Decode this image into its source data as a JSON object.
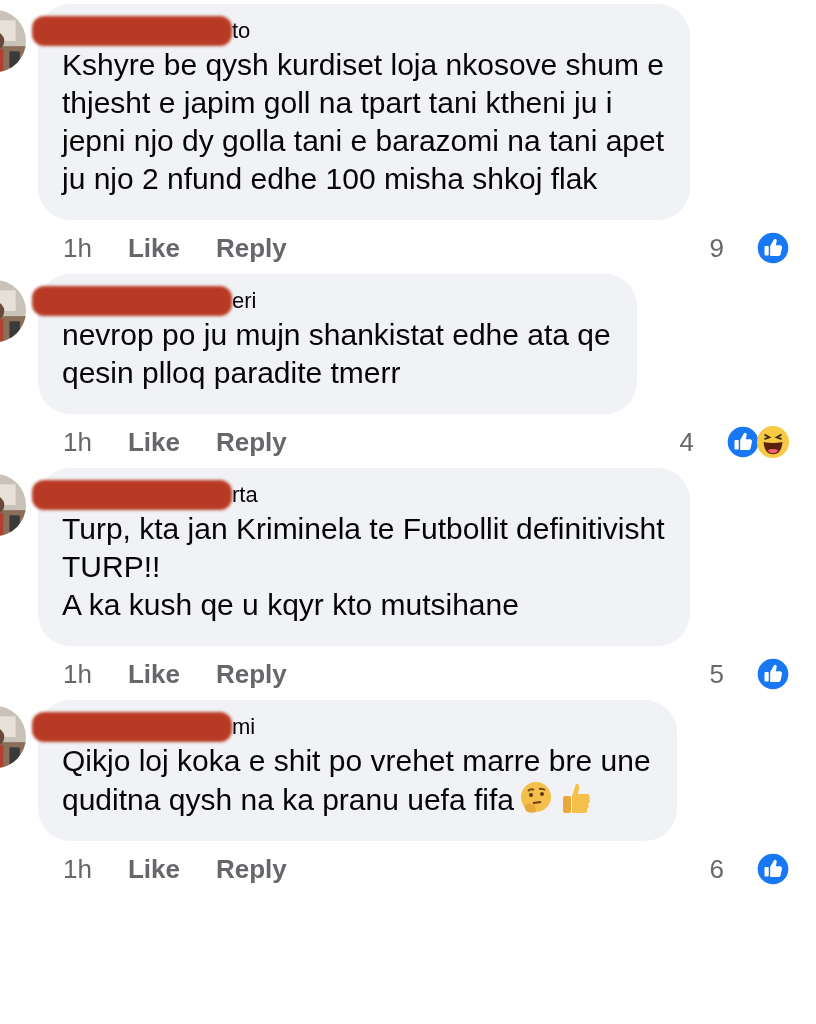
{
  "comments": [
    {
      "name_visible": "to",
      "text": "Kshyre be qysh kurdiset loja nkosove shum e\nthjesht e japim goll na tpart tani ktheni ju i\njepni njo dy golla tani e barazomi na tani apet\nju njo 2 nfund edhe 100 misha shkoj flak",
      "time": "1h",
      "like": "Like",
      "reply": "Reply",
      "count": "9",
      "reactions": [
        {
          "kind": "like"
        }
      ]
    },
    {
      "name_visible": "eri",
      "text": "nevrop po ju mujn shankistat edhe ata qe\nqesin plloq paradite tmerr",
      "time": "1h",
      "like": "Like",
      "reply": "Reply",
      "count": "4",
      "reactions": [
        {
          "kind": "like"
        },
        {
          "kind": "haha"
        }
      ]
    },
    {
      "name_visible": "rta",
      "text": "Turp, kta jan Kriminela te Futbollit definitivisht\nTURP!!\n A ka kush qe u kqyr kto mutsihane",
      "time": "1h",
      "like": "Like",
      "reply": "Reply",
      "count": "5",
      "reactions": [
        {
          "kind": "like"
        }
      ]
    },
    {
      "name_visible": "mi",
      "text": "Qikjo loj koka e shit po vrehet marre bre une\nquditna qysh na ka pranu uefa fifa",
      "emojis": [
        {
          "kind": "thinking"
        },
        {
          "kind": "thumbs-up"
        }
      ],
      "time": "1h",
      "like": "Like",
      "reply": "Reply",
      "count": "6",
      "reactions": [
        {
          "kind": "like"
        }
      ]
    }
  ]
}
